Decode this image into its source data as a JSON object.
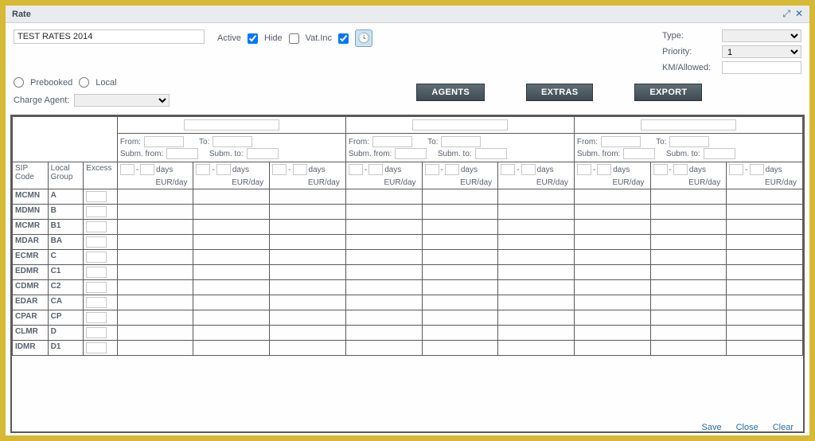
{
  "window": {
    "title": "Rate"
  },
  "header": {
    "name_value": "TEST RATES 2014",
    "active_label": "Active",
    "hide_label": "Hide",
    "vatinc_label": "Vat.Inc",
    "active_checked": true,
    "hide_checked": false,
    "vatinc_checked": true
  },
  "options": {
    "type_label": "Type:",
    "priority_label": "Priority:",
    "priority_value": "1",
    "km_label": "KM/Allowed:"
  },
  "row2": {
    "prebooked_label": "Prebooked",
    "local_label": "Local",
    "charge_label": "Charge Agent:"
  },
  "buttons": {
    "agents": "AGENTS",
    "extras": "EXTRAS",
    "export": "EXPORT"
  },
  "grid": {
    "sip_label": "SIP Code",
    "group_label": "Local Group",
    "excess_label": "Excess",
    "from_label": "From:",
    "to_label": "To:",
    "subm_from_label": "Subm. from:",
    "subm_to_label": "Subm. to:",
    "days_label": "days",
    "eur_label": "EUR/day",
    "dash": "-",
    "rows": [
      {
        "sip": "MCMN",
        "group": "A"
      },
      {
        "sip": "MDMN",
        "group": "B"
      },
      {
        "sip": "MCMR",
        "group": "B1"
      },
      {
        "sip": "MDAR",
        "group": "BA"
      },
      {
        "sip": "ECMR",
        "group": "C"
      },
      {
        "sip": "EDMR",
        "group": "C1"
      },
      {
        "sip": "CDMR",
        "group": "C2"
      },
      {
        "sip": "EDAR",
        "group": "CA"
      },
      {
        "sip": "CPAR",
        "group": "CP"
      },
      {
        "sip": "CLMR",
        "group": "D"
      },
      {
        "sip": "IDMR",
        "group": "D1"
      }
    ]
  },
  "footer": {
    "save": "Save",
    "close": "Close",
    "clear": "Clear"
  }
}
